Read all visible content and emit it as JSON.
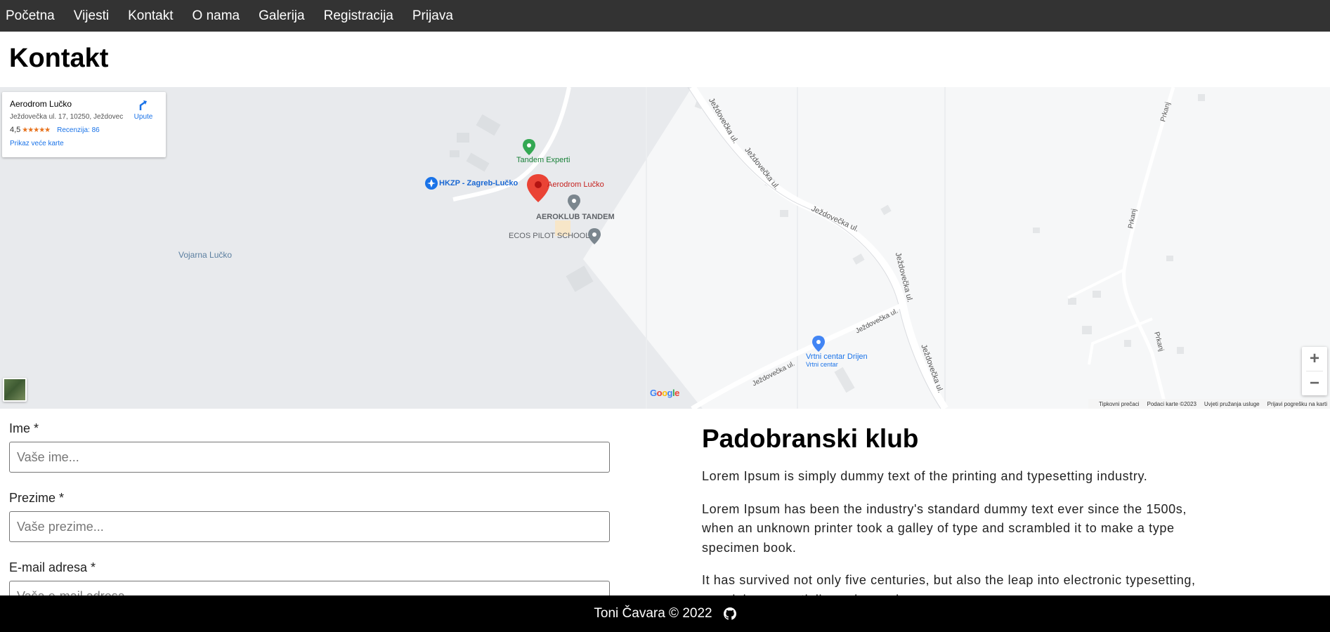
{
  "nav": {
    "items": [
      "Početna",
      "Vijesti",
      "Kontakt",
      "O nama",
      "Galerija",
      "Registracija",
      "Prijava"
    ]
  },
  "page": {
    "title": "Kontakt"
  },
  "map": {
    "card": {
      "title": "Aerodrom Lučko",
      "address": "Ježdovečka ul. 17, 10250, Ježdovec",
      "rating": "4,5",
      "stars": "★★★★★",
      "reviews": "Recenzija: 86",
      "larger_map": "Prikaz veće karte",
      "directions": "Upute"
    },
    "labels": {
      "tandem_experti": "Tandem Experti",
      "hkzp": "HKZP - Zagreb-Lučko",
      "aerodrom": "Aerodrom Lučko",
      "aeroklub": "AEROKLUB TANDEM",
      "ecos": "ECOS PILOT SCHOOL",
      "vojarna": "Vojarna Lučko",
      "vrtni": "Vrtni centar Drijen",
      "vrtni_sub": "Vrtni centar",
      "road": "Ježdovečka ul.",
      "prkanj": "Prkanj"
    },
    "zoom_in": "+",
    "zoom_out": "−",
    "logo": "Google",
    "attribution": [
      "Tipkovni prečaci",
      "Podaci karte ©2023",
      "Uvjeti pružanja usluge",
      "Prijavi pogrešku na karti"
    ],
    "colors": {
      "marker": "#ea4335",
      "poi_blue": "#1a73e8",
      "poi_green": "#34a853",
      "poi_gray": "#7b868e"
    }
  },
  "form": {
    "first_name_label": "Ime *",
    "first_name_placeholder": "Vaše ime...",
    "last_name_label": "Prezime *",
    "last_name_placeholder": "Vaše prezime...",
    "email_label": "E-mail adresa *",
    "email_placeholder": "Vaša e-mail adresa..."
  },
  "club": {
    "title": "Padobranski klub",
    "paragraphs": [
      "Lorem Ipsum is simply dummy text of the printing and typesetting industry.",
      "Lorem Ipsum has been the industry's standard dummy text ever since the 1500s, when an unknown printer took a galley of type and scrambled it to make a type specimen book.",
      "It has survived not only five centuries, but also the leap into electronic typesetting, remaining essentially unchanged."
    ]
  },
  "footer": {
    "text": "Toni Čavara © 2022",
    "icon": "github-icon"
  }
}
